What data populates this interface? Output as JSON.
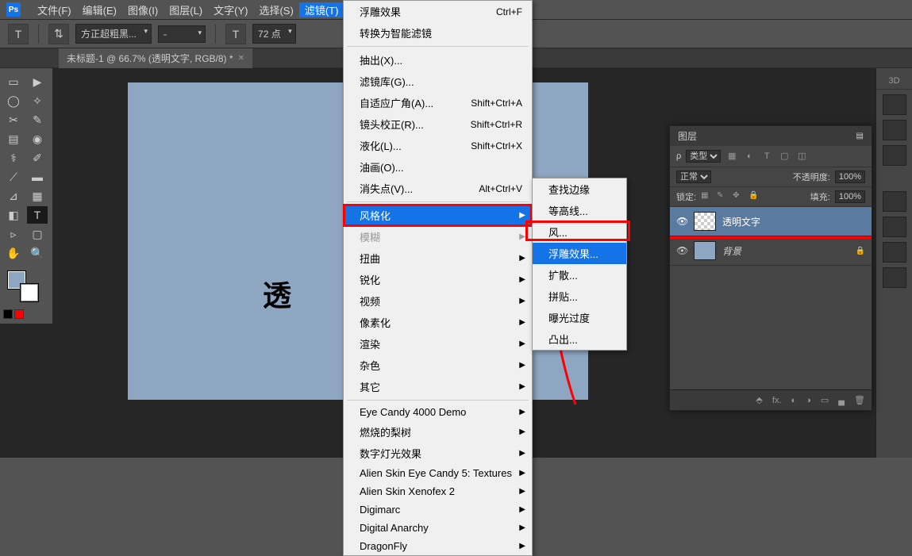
{
  "app": {
    "logo": "Ps"
  },
  "menubar": [
    "文件(F)",
    "编辑(E)",
    "图像(I)",
    "图层(L)",
    "文字(Y)",
    "选择(S)",
    "滤镜(T)"
  ],
  "active_menu_index": 6,
  "optbar": {
    "font": "方正超粗黑...",
    "size": "72 点"
  },
  "tab": {
    "title": "未标题-1 @ 66.7% (透明文字, RGB/8) *"
  },
  "canvas": {
    "text": "透"
  },
  "filter_menu": {
    "top": [
      {
        "label": "浮雕效果",
        "shortcut": "Ctrl+F"
      },
      {
        "label": "转换为智能滤镜"
      }
    ],
    "block2": [
      {
        "label": "抽出(X)..."
      },
      {
        "label": "滤镜库(G)..."
      },
      {
        "label": "自适应广角(A)...",
        "shortcut": "Shift+Ctrl+A"
      },
      {
        "label": "镜头校正(R)...",
        "shortcut": "Shift+Ctrl+R"
      },
      {
        "label": "液化(L)...",
        "shortcut": "Shift+Ctrl+X"
      },
      {
        "label": "油画(O)..."
      },
      {
        "label": "消失点(V)...",
        "shortcut": "Alt+Ctrl+V"
      }
    ],
    "block3": [
      {
        "label": "风格化",
        "sub": true,
        "hl": true,
        "red": true
      },
      {
        "label": "模糊",
        "sub": true,
        "disabled": true
      },
      {
        "label": "扭曲",
        "sub": true
      },
      {
        "label": "锐化",
        "sub": true
      },
      {
        "label": "视频",
        "sub": true
      },
      {
        "label": "像素化",
        "sub": true
      },
      {
        "label": "渲染",
        "sub": true
      },
      {
        "label": "杂色",
        "sub": true
      },
      {
        "label": "其它",
        "sub": true
      }
    ],
    "block4": [
      {
        "label": "Eye Candy 4000  Demo",
        "sub": true
      },
      {
        "label": "燃烧的梨树",
        "sub": true
      },
      {
        "label": "数字灯光效果",
        "sub": true
      },
      {
        "label": "Alien Skin Eye Candy 5: Textures",
        "sub": true
      },
      {
        "label": "Alien Skin Xenofex 2",
        "sub": true
      },
      {
        "label": "Digimarc",
        "sub": true
      },
      {
        "label": "Digital Anarchy",
        "sub": true
      },
      {
        "label": "DragonFly",
        "sub": true
      }
    ]
  },
  "submenu": [
    {
      "label": "查找边缘"
    },
    {
      "label": "等高线..."
    },
    {
      "label": "风..."
    },
    {
      "label": "浮雕效果...",
      "hl": true
    },
    {
      "label": "扩散..."
    },
    {
      "label": "拼贴..."
    },
    {
      "label": "曝光过度"
    },
    {
      "label": "凸出..."
    }
  ],
  "rightbar": {
    "tab3d": "3D"
  },
  "layers_panel": {
    "title": "图层",
    "kind": "类型",
    "mode": "正常",
    "opacity_label": "不透明度:",
    "opacity": "100%",
    "lock_label": "锁定:",
    "fill_label": "填充:",
    "fill": "100%",
    "layers": [
      {
        "name": "透明文字",
        "sel": true,
        "red": true
      },
      {
        "name": "背景",
        "locked": true,
        "italic": true
      }
    ]
  }
}
